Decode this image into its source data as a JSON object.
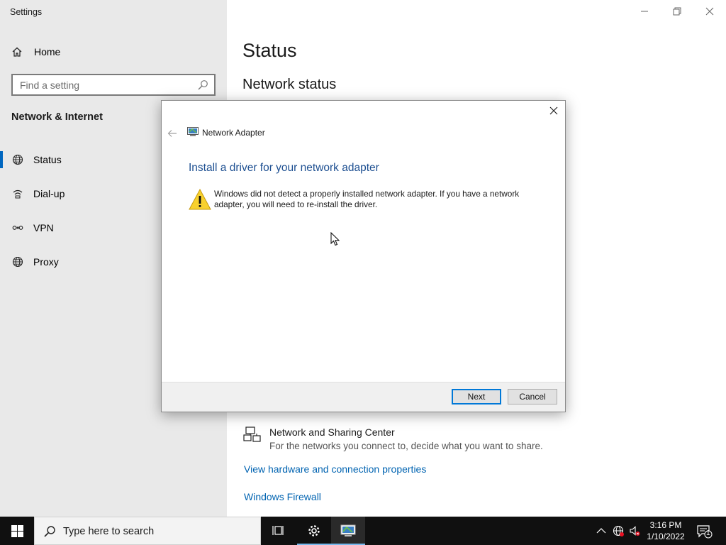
{
  "window": {
    "app_title": "Settings",
    "controls": {
      "minimize": "minimize-icon",
      "restore": "restore-icon",
      "close": "close-icon"
    }
  },
  "sidebar": {
    "home_label": "Home",
    "search_placeholder": "Find a setting",
    "section_title": "Network & Internet",
    "items": [
      {
        "label": "Status",
        "icon": "globe-icon",
        "selected": true
      },
      {
        "label": "Dial-up",
        "icon": "dialup-icon",
        "selected": false
      },
      {
        "label": "VPN",
        "icon": "vpn-icon",
        "selected": false
      },
      {
        "label": "Proxy",
        "icon": "globe-icon",
        "selected": false
      }
    ]
  },
  "main": {
    "page_title": "Status",
    "subtitle": "Network status",
    "sharing_center": {
      "title": "Network and Sharing Center",
      "description": "For the networks you connect to, decide what you want to share."
    },
    "links": [
      "View hardware and connection properties",
      "Windows Firewall"
    ]
  },
  "dialog": {
    "app_title": "Network Adapter",
    "heading": "Install a driver for your network adapter",
    "message": "Windows did not detect a properly installed network adapter. If you have a network adapter, you will need to re-install the driver.",
    "buttons": {
      "next": "Next",
      "cancel": "Cancel"
    }
  },
  "taskbar": {
    "search_placeholder": "Type here to search",
    "time": "3:16 PM",
    "date": "1/10/2022",
    "notification_count": "1"
  },
  "colors": {
    "accent": "#0078d7",
    "link": "#0063b1",
    "heading_blue": "#1d4f91",
    "sidebar_bg": "#e9e9e9",
    "taskbar_bg": "#101010"
  }
}
